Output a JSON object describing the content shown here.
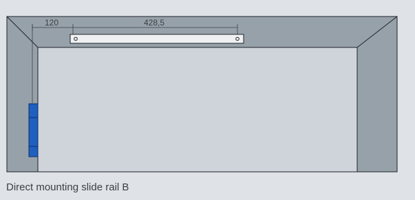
{
  "dimensions": {
    "left_offset": "120",
    "rail_length": "428,5"
  },
  "caption": "Direct mounting slide rail B",
  "colors": {
    "background": "#dfe3e7",
    "frame": "#97a1aa",
    "door_panel": "#ced4da",
    "outline": "#1d2226",
    "rail": "#eef0f2",
    "hinge": "#1f5fbf"
  }
}
